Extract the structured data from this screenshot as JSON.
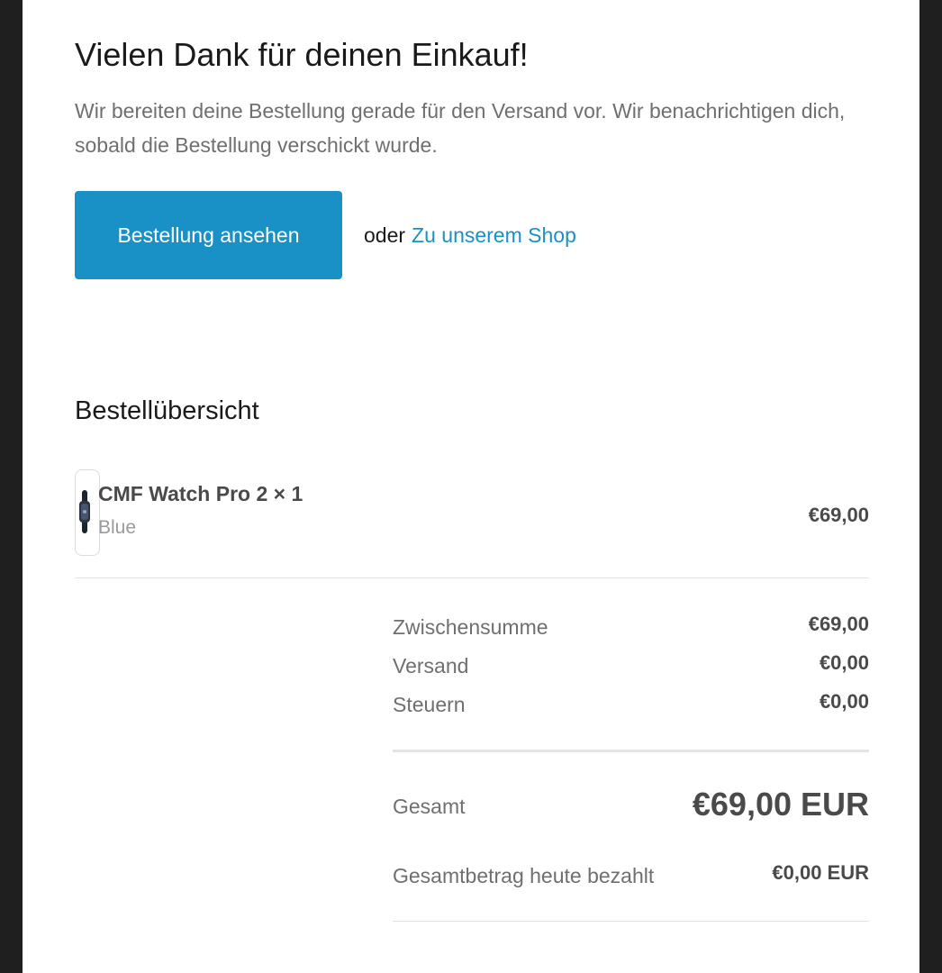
{
  "header": {
    "title": "Vielen Dank für deinen Einkauf!",
    "subtitle": "Wir bereiten deine Bestellung gerade für den Versand vor. Wir benachrichtigen dich, sobald die Bestellung verschickt wurde."
  },
  "actions": {
    "view_order_label": "Bestellung ansehen",
    "or_text": "oder",
    "shop_link_label": "Zu unserem Shop"
  },
  "summary": {
    "heading": "Bestellübersicht",
    "items": [
      {
        "name": "CMF Watch Pro 2 × 1",
        "variant": "Blue",
        "price": "€69,00",
        "thumbnail_icon": "watch-icon"
      }
    ]
  },
  "totals": {
    "subtotal_label": "Zwischensumme",
    "subtotal_value": "€69,00",
    "shipping_label": "Versand",
    "shipping_value": "€0,00",
    "taxes_label": "Steuern",
    "taxes_value": "€0,00",
    "total_label": "Gesamt",
    "total_value": "€69,00 EUR",
    "paid_today_label": "Gesamtbetrag heute bezahlt",
    "paid_today_value": "€0,00 EUR"
  },
  "colors": {
    "accent": "#1990c6",
    "background_outer": "#1f1f1f",
    "text_primary": "#1a1a1a",
    "text_secondary": "#6f6f6f"
  }
}
